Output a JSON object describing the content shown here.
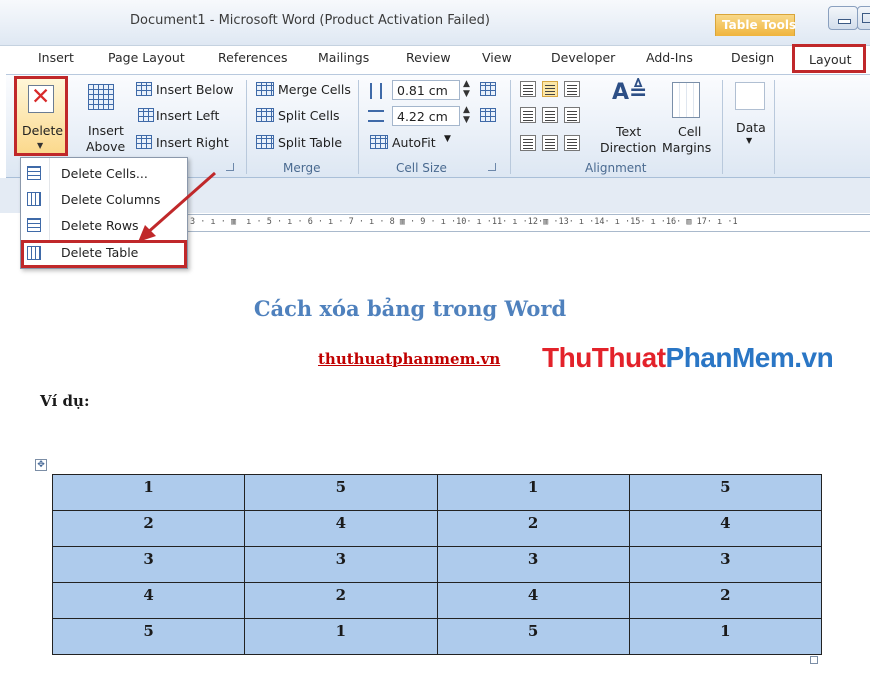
{
  "window": {
    "title": "Document1  -  Microsoft Word (Product Activation Failed)",
    "context_tab_group": "Table Tools"
  },
  "tabs": [
    "Insert",
    "Page Layout",
    "References",
    "Mailings",
    "Review",
    "View",
    "Developer",
    "Add-Ins",
    "Design",
    "Layout"
  ],
  "ribbon": {
    "delete_label": "Delete",
    "insert_above_line1": "Insert",
    "insert_above_line2": "Above",
    "insert_below": "Insert Below",
    "insert_left": "Insert Left",
    "insert_right": "Insert Right",
    "merge_cells": "Merge Cells",
    "split_cells": "Split Cells",
    "split_table": "Split Table",
    "height_value": "0.81 cm",
    "width_value": "4.22 cm",
    "autofit": "AutoFit",
    "text_direction_line1": "Text",
    "text_direction_line2": "Direction",
    "cell_margins_line1": "Cell",
    "cell_margins_line2": "Margins",
    "data_label": "Data",
    "groups": {
      "merge": "Merge",
      "cell_size": "Cell Size",
      "alignment": "Alignment"
    }
  },
  "delete_menu": {
    "items": [
      {
        "label": "Delete Cells...",
        "icon": "delete-cells-icon"
      },
      {
        "label": "Delete Columns",
        "icon": "delete-columns-icon"
      },
      {
        "label": "Delete Rows",
        "icon": "delete-rows-icon"
      },
      {
        "label": "Delete Table",
        "icon": "delete-table-icon"
      }
    ]
  },
  "ruler_text": "3 · ı · ▥  ı · 5 · ı · 6 · ı · 7 · ı · 8 ▥ · 9 · ı ·10· ı ·11· ı ·12·▥ ·13· ı ·14· ı ·15· ı ·16· ▥ 17· ı ·1",
  "document": {
    "heading": "Cách xóa bảng trong Word",
    "link": "thuthuatphanmem.vn",
    "logo_part1": "ThuThuat",
    "logo_part2": "PhanMem.vn",
    "example_label": "Ví dụ:",
    "table": [
      [
        "1",
        "5",
        "1",
        "5"
      ],
      [
        "2",
        "4",
        "2",
        "4"
      ],
      [
        "3",
        "3",
        "3",
        "3"
      ],
      [
        "4",
        "2",
        "4",
        "2"
      ],
      [
        "5",
        "1",
        "5",
        "1"
      ]
    ]
  },
  "colors": {
    "highlight_border": "#c0282a",
    "table_fill": "#aecbec",
    "heading": "#4f81bd",
    "link": "#c00000"
  }
}
